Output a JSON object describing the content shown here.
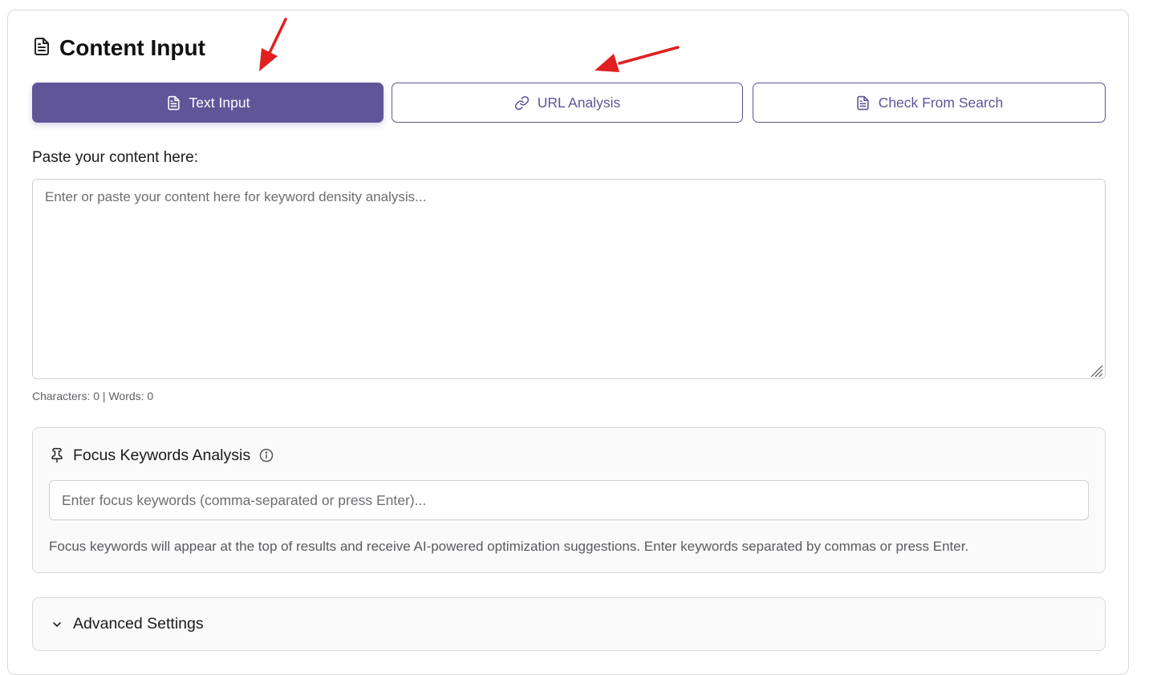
{
  "header": {
    "title": "Content Input",
    "title_icon": "document-icon"
  },
  "tabs": [
    {
      "label": "Text Input",
      "icon": "document-icon",
      "active": true
    },
    {
      "label": "URL Analysis",
      "icon": "link-icon",
      "active": false
    },
    {
      "label": "Check From Search",
      "icon": "document-icon",
      "active": false
    }
  ],
  "content": {
    "label": "Paste your content here:",
    "value": "",
    "placeholder": "Enter or paste your content here for keyword density analysis...",
    "counts": "Characters: 0 | Words: 0"
  },
  "focus": {
    "title": "Focus Keywords Analysis",
    "title_icon": "pin-icon",
    "info_icon": "info-icon",
    "value": "",
    "placeholder": "Enter focus keywords (comma-separated or press Enter)...",
    "help": "Focus keywords will appear at the top of results and receive AI-powered optimization suggestions. Enter keywords separated by commas or press Enter."
  },
  "advanced": {
    "title": "Advanced Settings",
    "icon": "chevron-down-icon"
  },
  "colors": {
    "accent": "#61559a",
    "annotation": "#e02020"
  }
}
